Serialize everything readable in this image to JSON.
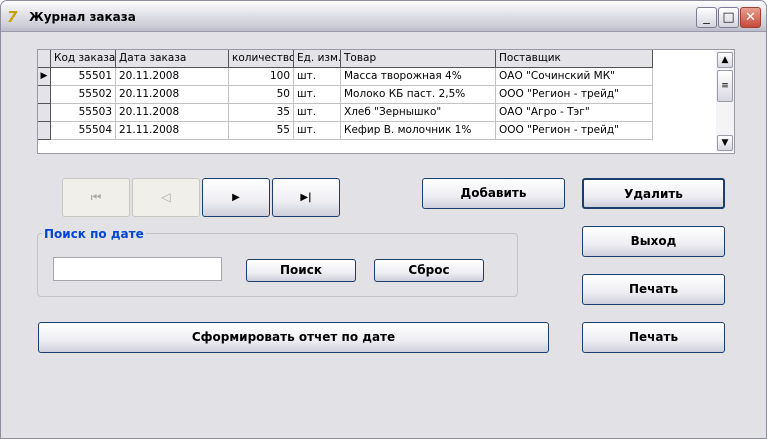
{
  "window": {
    "title": "Журнал заказа",
    "app_icon": "delphi-app-icon",
    "minimize": "_",
    "maximize": "□",
    "close": "✕"
  },
  "grid": {
    "columns": [
      "Код заказа",
      "Дата заказа",
      "количество",
      "Ед. изм.",
      "Товар",
      "Поставщик"
    ],
    "rows": [
      [
        "55501",
        "20.11.2008",
        "100",
        "шт.",
        "Масса творожная 4%",
        "ОАО \"Сочинский МК\""
      ],
      [
        "55502",
        "20.11.2008",
        "50",
        "шт.",
        "Молоко КБ паст. 2,5%",
        "ООО \"Регион - трейд\""
      ],
      [
        "55503",
        "20.11.2008",
        "35",
        "шт.",
        "Хлеб \"Зернышко\"",
        "ОАО \"Агро - Тэг\""
      ],
      [
        "55504",
        "21.11.2008",
        "55",
        "шт.",
        "Кефир В. молочник 1%",
        "ООО \"Регион - трейд\""
      ]
    ],
    "current_row_marker": "▶"
  },
  "navigator": {
    "first": "⏮",
    "prior": "◁",
    "next": "▶",
    "last": "▶|"
  },
  "search": {
    "legend": "Поиск по дате",
    "value": "",
    "search_label": "Поиск",
    "reset_label": "Сброс"
  },
  "buttons": {
    "add": "Добавить",
    "delete": "Удалить",
    "exit": "Выход",
    "print1": "Печать",
    "print2": "Печать",
    "report": "Сформировать отчет по дате"
  }
}
